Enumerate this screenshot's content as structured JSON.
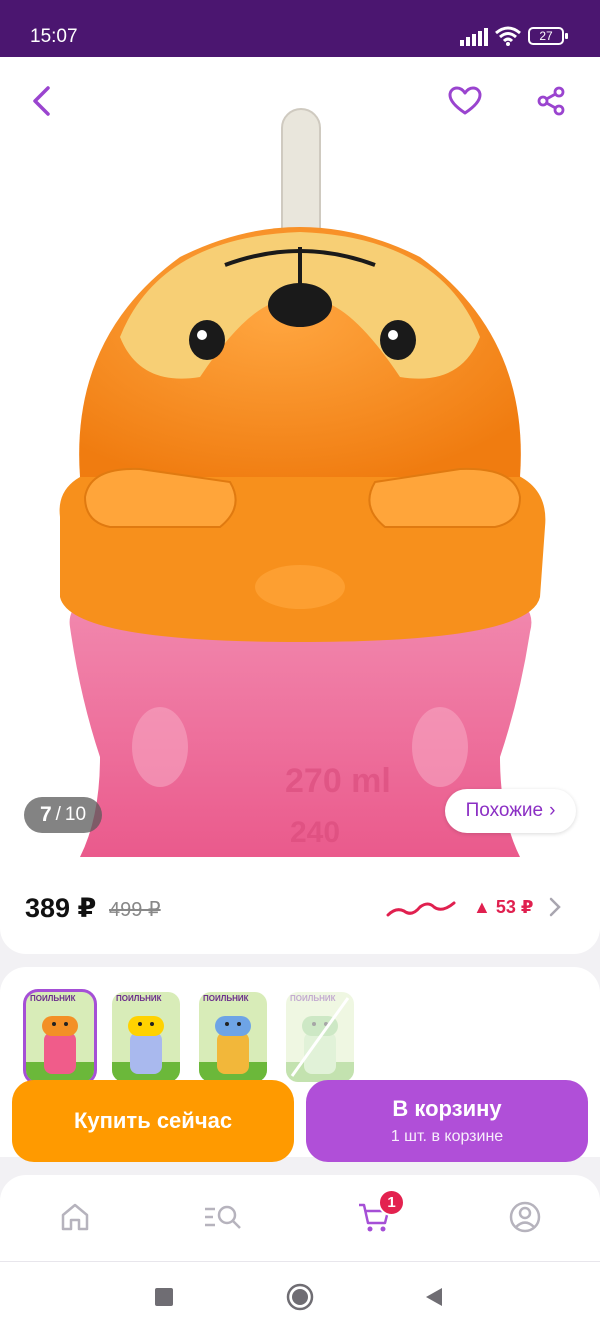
{
  "status_bar": {
    "time": "15:07",
    "battery": "27"
  },
  "gallery": {
    "current": "7",
    "separator": "/",
    "total": "10",
    "similar_label": "Похожие",
    "similar_chevron": "›"
  },
  "price": {
    "current": "389 ₽",
    "old": "499 ₽",
    "delta_arrow": "▲",
    "delta": "53 ₽"
  },
  "variants": {
    "items": [
      {
        "brand": "ПОИЛЬНИК",
        "state": "selected",
        "body_color": "#f05c8a",
        "cap_color": "#f39026"
      },
      {
        "brand": "ПОИЛЬНИК",
        "state": "normal",
        "body_color": "#a9b9ee",
        "cap_color": "#ffd200"
      },
      {
        "brand": "ПОИЛЬНИК",
        "state": "normal",
        "body_color": "#f2b73a",
        "cap_color": "#6ea4e6"
      },
      {
        "brand": "ПОИЛЬНИК",
        "state": "unavailable",
        "body_color": "#b6e0a0",
        "cap_color": "#84c76f"
      }
    ]
  },
  "actions": {
    "buy_now": "Купить сейчас",
    "add_to_cart": "В корзину",
    "in_cart_note": "1 шт. в корзине"
  },
  "tabbar": {
    "cart_badge": "1"
  },
  "colors": {
    "brand_purple": "#8b2fc4",
    "orange": "#ff9a00",
    "button_purple": "#b04fd8",
    "status_purple": "#4b1670",
    "red": "#e0204f"
  },
  "icons": [
    "back-icon",
    "heart-icon",
    "share-icon",
    "trend-icon",
    "chevron-right-icon",
    "home-icon",
    "catalog-search-icon",
    "cart-icon",
    "profile-icon",
    "nav-square-icon",
    "nav-circle-icon",
    "nav-back-icon"
  ]
}
